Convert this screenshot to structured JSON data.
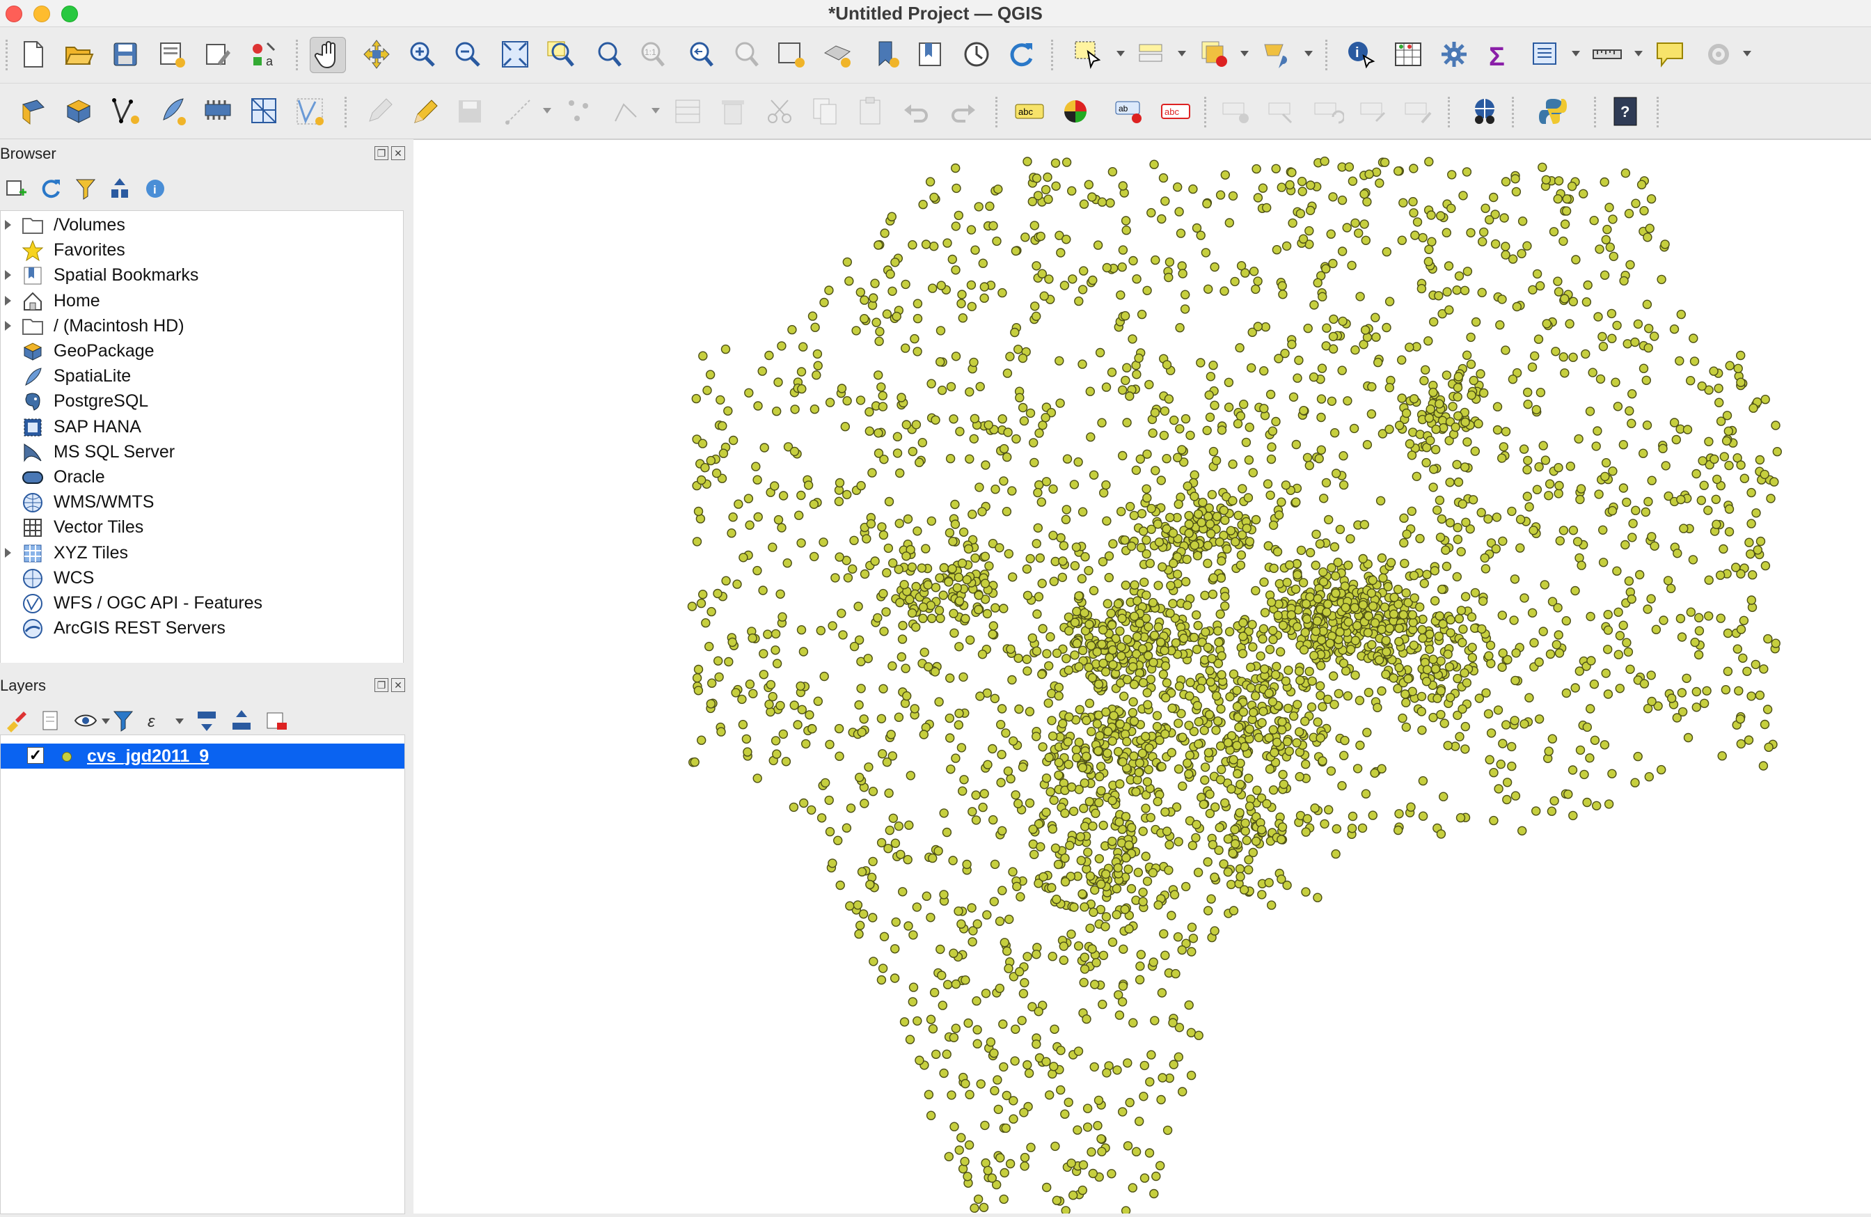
{
  "window": {
    "title": "*Untitled Project — QGIS"
  },
  "toolbar1": [
    "new-project",
    "open-project",
    "save-project",
    "save-as",
    "print-layout",
    "style-manager",
    "pan-map",
    "pan-to-selection",
    "zoom-in",
    "zoom-out",
    "zoom-full",
    "zoom-to-selection",
    "zoom-to-layer",
    "zoom-native",
    "zoom-last",
    "zoom-next",
    "new-bookmark",
    "show-bookmarks",
    "temporal-controller",
    "refresh",
    "select-features",
    "select-by-value",
    "deselect",
    "select-by-location",
    "identify",
    "attribute-table",
    "processing-toolbox",
    "statistics",
    "open-field-calculator",
    "measure",
    "map-tips",
    "settings"
  ],
  "toolbar2": [
    "data-source-manager",
    "new-geopackage",
    "new-shapefile",
    "new-spatialite",
    "new-virtual-layer",
    "new-temporary-scratch",
    "new-mesh",
    "toggle-editing",
    "current-edits",
    "save-edits",
    "add-feature",
    "vertex-tool",
    "digitize",
    "modify-attributes",
    "delete",
    "cut",
    "copy",
    "paste",
    "undo",
    "redo",
    "label-toolbar",
    "diagram",
    "label-pin",
    "label-highlight",
    "label-show",
    "label-move",
    "label-rotate",
    "label-change",
    "metasearch",
    "python-console",
    "help"
  ],
  "browser": {
    "title": "Browser",
    "items": [
      {
        "label": "/Volumes",
        "icon": "folder-icon",
        "expandable": true
      },
      {
        "label": "Favorites",
        "icon": "star-icon",
        "expandable": false
      },
      {
        "label": "Spatial Bookmarks",
        "icon": "bookmark-icon",
        "expandable": true
      },
      {
        "label": "Home",
        "icon": "home-icon",
        "expandable": true
      },
      {
        "label": "/ (Macintosh HD)",
        "icon": "folder-icon",
        "expandable": true
      },
      {
        "label": "GeoPackage",
        "icon": "geopackage-icon",
        "expandable": false
      },
      {
        "label": "SpatiaLite",
        "icon": "spatialite-icon",
        "expandable": false
      },
      {
        "label": "PostgreSQL",
        "icon": "postgresql-icon",
        "expandable": false
      },
      {
        "label": "SAP HANA",
        "icon": "saphana-icon",
        "expandable": false
      },
      {
        "label": "MS SQL Server",
        "icon": "mssql-icon",
        "expandable": false
      },
      {
        "label": "Oracle",
        "icon": "oracle-icon",
        "expandable": false
      },
      {
        "label": "WMS/WMTS",
        "icon": "wms-icon",
        "expandable": false
      },
      {
        "label": "Vector Tiles",
        "icon": "vector-tiles-icon",
        "expandable": false
      },
      {
        "label": "XYZ Tiles",
        "icon": "xyz-tiles-icon",
        "expandable": true
      },
      {
        "label": "WCS",
        "icon": "wcs-icon",
        "expandable": false
      },
      {
        "label": "WFS / OGC API - Features",
        "icon": "wfs-icon",
        "expandable": false
      },
      {
        "label": "ArcGIS REST Servers",
        "icon": "arcgis-icon",
        "expandable": false
      }
    ]
  },
  "layers": {
    "title": "Layers",
    "items": [
      {
        "name": "cvs_jgd2011_9",
        "checked": true,
        "selected": true
      }
    ]
  },
  "map": {
    "point_fill": "#c6cf3e",
    "point_stroke": "#4d5016"
  }
}
